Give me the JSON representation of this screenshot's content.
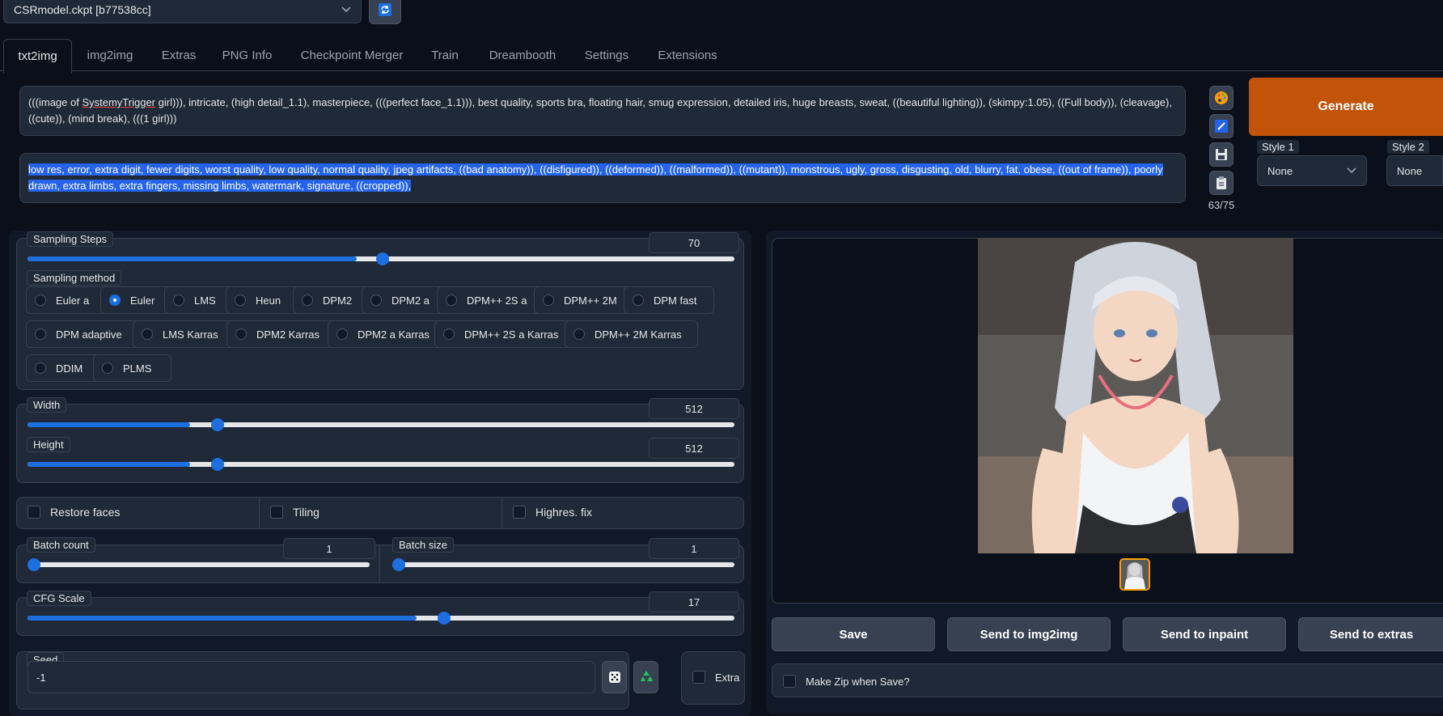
{
  "model": {
    "value": "CSRmodel.ckpt [b77538cc]"
  },
  "tabs": [
    "txt2img",
    "img2img",
    "Extras",
    "PNG Info",
    "Checkpoint Merger",
    "Train",
    "Dreambooth",
    "Settings",
    "Extensions"
  ],
  "prompt": {
    "before": "(((image of ",
    "underlined": "SystemyTrigger",
    "after": " girl))), intricate, (high detail_1.1), masterpiece, (((perfect face_1.1))), best quality, sports bra, floating hair, smug expression, detailed iris, huge breasts, sweat, ((beautiful lighting)), (skimpy:1.05), ((Full body)), (cleavage), ((cute)), (mind break), (((1 girl)))"
  },
  "negative_prompt": "low res, error, extra digit, fewer digits, worst quality, low quality, normal quality, jpeg artifacts, ((bad anatomy)), ((disfigured)), ((deformed)), ((malformed)), ((mutant)), monstrous, ugly, gross, disgusting, old, blurry, fat, obese, ((out of frame)), poorly drawn, extra limbs, extra fingers, missing limbs, watermark, signature, ((cropped)),",
  "token_count": "63/75",
  "generate_label": "Generate",
  "styles": [
    {
      "label": "Style 1",
      "value": "None"
    },
    {
      "label": "Style 2",
      "value": "None"
    }
  ],
  "sampling_steps": {
    "label": "Sampling Steps",
    "value": "70",
    "fraction": 0.47
  },
  "sampling_method": {
    "label": "Sampling method",
    "options": [
      "Euler a",
      "Euler",
      "LMS",
      "Heun",
      "DPM2",
      "DPM2 a",
      "DPM++ 2S a",
      "DPM++ 2M",
      "DPM fast",
      "DPM adaptive",
      "LMS Karras",
      "DPM2 Karras",
      "DPM2 a Karras",
      "DPM++ 2S a Karras",
      "DPM++ 2M Karras",
      "DDIM",
      "PLMS"
    ],
    "selected": "Euler"
  },
  "width": {
    "label": "Width",
    "value": "512",
    "fraction": 0.23
  },
  "height": {
    "label": "Height",
    "value": "512",
    "fraction": 0.23
  },
  "checkboxes": {
    "restore_faces": "Restore faces",
    "tiling": "Tiling",
    "highres_fix": "Highres. fix"
  },
  "batch_count": {
    "label": "Batch count",
    "value": "1",
    "fraction": 0
  },
  "batch_size": {
    "label": "Batch size",
    "value": "1",
    "fraction": 0
  },
  "cfg_scale": {
    "label": "CFG Scale",
    "value": "17",
    "fraction": 0.55
  },
  "seed": {
    "label": "Seed",
    "value": "-1",
    "extra_label": "Extra"
  },
  "output_buttons": [
    "Save",
    "Send to img2img",
    "Send to inpaint",
    "Send to extras"
  ],
  "make_zip_label": "Make Zip when Save?",
  "colors": {
    "accent": "#1d6fe0",
    "generate": "#c2540a",
    "background": "#0b0f19"
  }
}
